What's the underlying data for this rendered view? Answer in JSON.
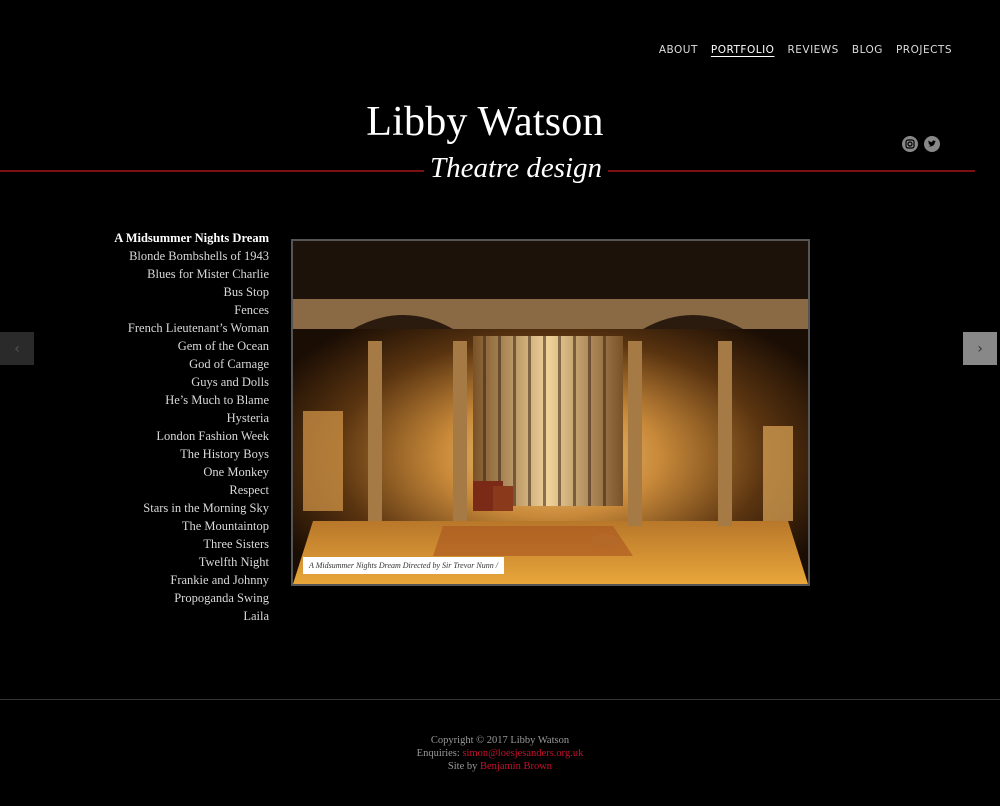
{
  "nav": {
    "items": [
      {
        "label": "ABOUT"
      },
      {
        "label": "PORTFOLIO",
        "active": true
      },
      {
        "label": "REVIEWS"
      },
      {
        "label": "BLOG"
      },
      {
        "label": "PROJECTS"
      }
    ]
  },
  "header": {
    "title": "Libby Watson",
    "subtitle": "Theatre design",
    "social": [
      {
        "icon": "instagram-icon"
      },
      {
        "icon": "twitter-icon"
      }
    ]
  },
  "sidebar": {
    "items": [
      {
        "label": "A Midsummer Nights Dream",
        "active": true
      },
      {
        "label": "Blonde Bombshells of 1943"
      },
      {
        "label": "Blues for Mister Charlie"
      },
      {
        "label": "Bus Stop"
      },
      {
        "label": "Fences"
      },
      {
        "label": "French Lieutenant’s Woman"
      },
      {
        "label": "Gem of the Ocean"
      },
      {
        "label": "God of Carnage"
      },
      {
        "label": "Guys and Dolls"
      },
      {
        "label": "He’s Much to Blame"
      },
      {
        "label": "Hysteria"
      },
      {
        "label": "London Fashion Week"
      },
      {
        "label": "The History Boys"
      },
      {
        "label": "One Monkey"
      },
      {
        "label": "Respect"
      },
      {
        "label": "Stars in the Morning Sky"
      },
      {
        "label": "The Mountaintop"
      },
      {
        "label": "Three Sisters"
      },
      {
        "label": "Twelfth Night"
      },
      {
        "label": "Frankie and Johnny"
      },
      {
        "label": "Propoganda Swing"
      },
      {
        "label": "Laila"
      }
    ]
  },
  "slideshow": {
    "caption": "A Midsummer Nights Dream Directed by Sir Trevor Nunn /",
    "prev_icon": "chevron-left-icon",
    "next_icon": "chevron-right-icon"
  },
  "footer": {
    "copyright": "Copyright © 2017 Libby Watson",
    "enquiries_label": "Enquiries:",
    "email": "simon@loesjesanders.org.uk",
    "site_by_label": "Site by",
    "site_by_name": "Benjamin Brown"
  },
  "colors": {
    "background": "#000000",
    "rule": "#7a1012",
    "link_accent": "#c8102e"
  }
}
